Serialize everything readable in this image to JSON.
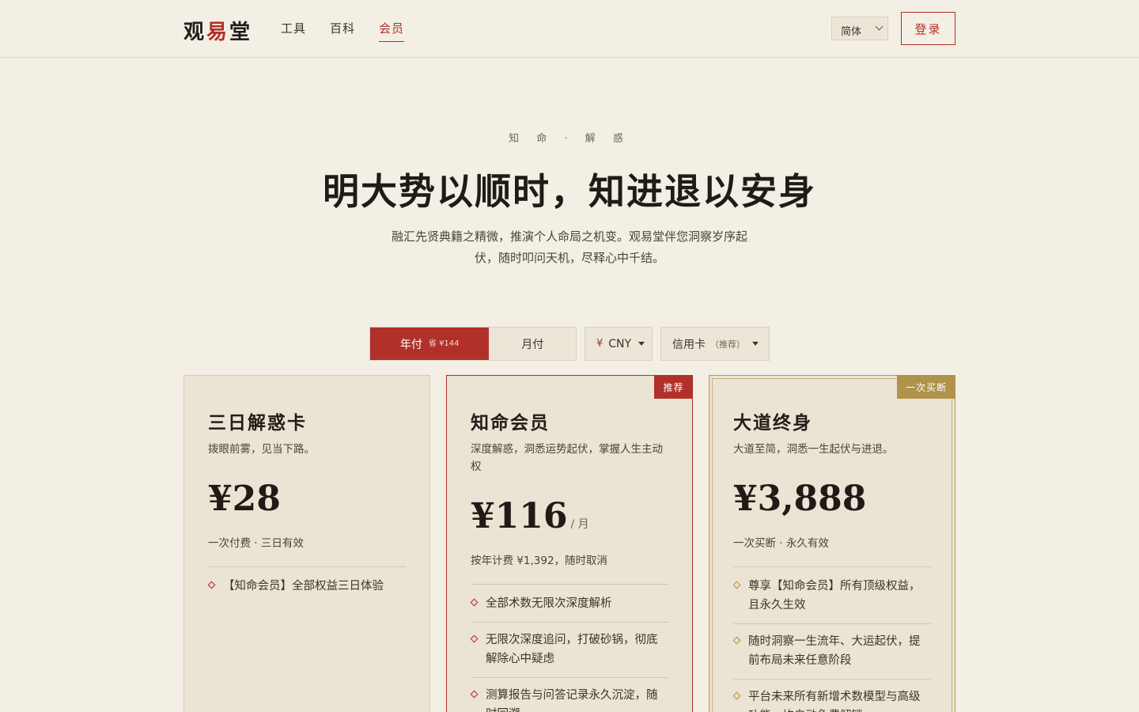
{
  "header": {
    "logo": {
      "part1": "观",
      "part2": "易",
      "part3": "堂"
    },
    "nav": [
      {
        "label": "工具",
        "active": false
      },
      {
        "label": "百科",
        "active": false
      },
      {
        "label": "会员",
        "active": true
      }
    ],
    "language": "简体",
    "login_label": "登录"
  },
  "hero": {
    "eyebrow": "知 命 · 解 惑",
    "title": "明大势以顺时，知进退以安身",
    "subtitle": "融汇先贤典籍之精微，推演个人命局之机变。观易堂伴您洞察岁序起伏，随时叩问天机，尽释心中千结。"
  },
  "controls": {
    "billing": {
      "yearly_label": "年付",
      "yearly_save": "省 ¥144",
      "monthly_label": "月付",
      "selected": "yearly"
    },
    "currency": {
      "symbol": "¥",
      "code": "CNY"
    },
    "payment": {
      "method": "信用卡",
      "hint": "（推荐）"
    }
  },
  "plans": [
    {
      "name": "三日解惑卡",
      "desc": "拨眼前雾，见当下路。",
      "price": "¥28",
      "unit": "",
      "note": "一次付费 · 三日有效",
      "badge": "",
      "features": [
        "【知命会员】全部权益三日体验"
      ]
    },
    {
      "name": "知命会员",
      "desc": "深度解惑，洞悉运势起伏，掌握人生主动权",
      "price": "¥116",
      "unit": "/ 月",
      "note": "按年计费 ¥1,392，随时取消",
      "badge": "推荐",
      "features": [
        "全部术数无限次深度解析",
        "无限次深度追问，打破砂锅，彻底解除心中疑虑",
        "测算报告与问答记录永久沉淀，随时回溯"
      ]
    },
    {
      "name": "大道终身",
      "desc": "大道至简，洞悉一生起伏与进退。",
      "price": "¥3,888",
      "unit": "",
      "note": "一次买断 · 永久有效",
      "badge": "一次买断",
      "features": [
        "尊享【知命会员】所有顶级权益，且永久生效",
        "随时洞察一生流年、大运起伏，提前布局未来任意阶段",
        "平台未来所有新增术数模型与高级功能，均自动免费解锁"
      ]
    }
  ],
  "colors": {
    "accent": "#b1302a",
    "gold": "#b0924a",
    "background": "#f3efe4",
    "card": "#ebe3d3"
  }
}
